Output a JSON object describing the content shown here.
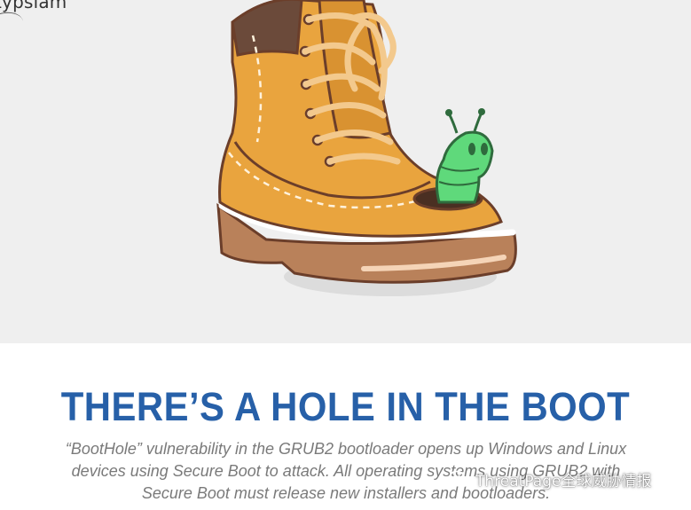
{
  "hero": {
    "brand_text": "typsiam",
    "image_alt": "Boot with a green worm peeking out of a hole"
  },
  "article": {
    "headline": "THERE’S A HOLE IN THE BOOT",
    "description": "“BootHole” vulnerability in the GRUB2 bootloader opens up Windows and Linux devices using Secure Boot to attack. All operating systems using GRUB2 with Secure Boot must release new installers and bootloaders."
  },
  "watermark": {
    "text": "ThreatPage全球威胁情报",
    "icon": "wechat-icon"
  },
  "colors": {
    "hero_bg": "#efefef",
    "headline": "#2760a8",
    "boot_leather": "#e9a43e",
    "boot_sole": "#b9815a",
    "worm": "#5fd97b"
  }
}
